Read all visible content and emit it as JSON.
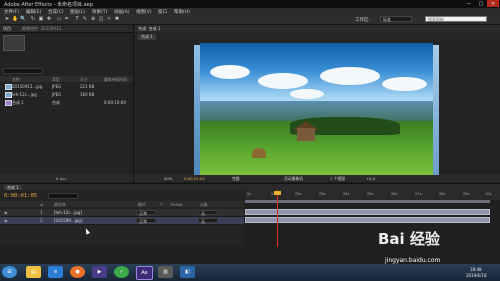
{
  "window": {
    "title": "Adobe After Effects - 未命名项目.aep",
    "controls": [
      "─",
      "□",
      "✕"
    ]
  },
  "menu": [
    "文件(F)",
    "编辑(E)",
    "合成(C)",
    "图层(L)",
    "效果(T)",
    "动画(A)",
    "视图(V)",
    "窗口",
    "帮助(H)"
  ],
  "workspace": {
    "label": "工作区:",
    "value": "标准",
    "search_placeholder": "搜索帮助"
  },
  "project_panel": {
    "tabs": [
      "项目",
      "效果控件: 20150913..."
    ],
    "columns": [
      "名称",
      "类型",
      "大小",
      "媒体持续时间"
    ],
    "items": [
      {
        "name": "20150913...jpg",
        "type": "JPEG",
        "size": "221 KB"
      },
      {
        "name": "leh-12c...jpg",
        "type": "JPEG",
        "size": "160 KB"
      },
      {
        "name": "合成 1",
        "type": "合成",
        "duration": "0:00:10:00"
      }
    ],
    "footer": "8 bpc"
  },
  "composition_panel": {
    "tab": "合成: 合成 1",
    "subtab": "合成 1",
    "footer": [
      "50%",
      "0:00:01:05",
      "完整",
      "活动摄像机",
      "1 个视图",
      "+0.0"
    ]
  },
  "timeline": {
    "tab": "合成 1",
    "timecode": "0:00:01:05",
    "columns": [
      "#",
      "源名称",
      "模式",
      "T",
      "TrkMat",
      "父级"
    ],
    "layers": [
      {
        "index": "1",
        "name": "[leh-12c...jpg]",
        "mode": "正常",
        "parent": "无"
      },
      {
        "index": "2",
        "name": "[201509...jpg]",
        "mode": "正常",
        "parent": "无"
      }
    ],
    "ruler": [
      "0s",
      "01s",
      "02s",
      "03s",
      "04s",
      "05s",
      "06s",
      "07s",
      "08s",
      "09s",
      "10s"
    ]
  },
  "taskbar": {
    "clock_time": "18:48",
    "clock_date": "2019/6/18",
    "ae_label": "Ae"
  },
  "watermark": {
    "brand": "Bai 经验",
    "url": "jingyan.baidu.com"
  }
}
